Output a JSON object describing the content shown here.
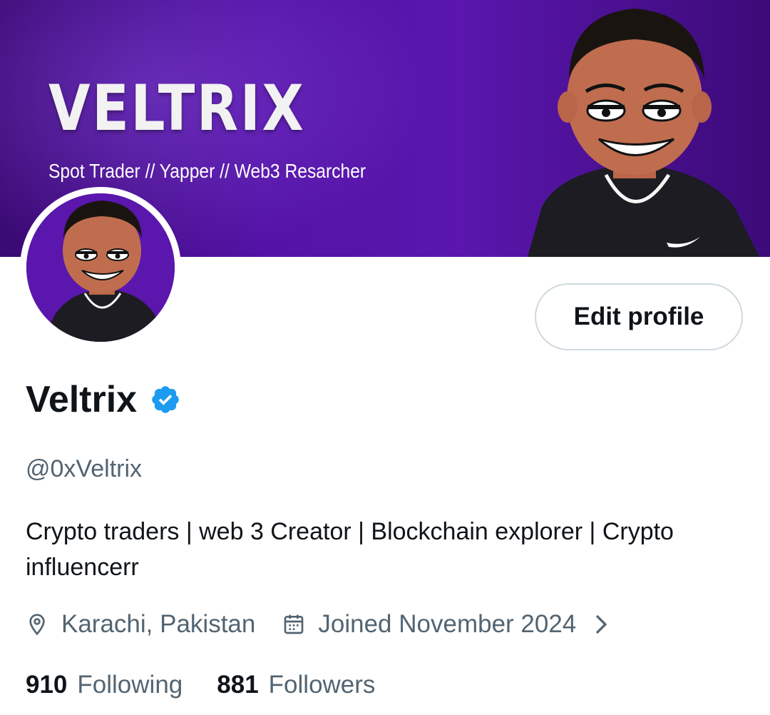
{
  "banner": {
    "title": "VELTRIX",
    "subtitle": "Spot Trader // Yapper // Web3 Resarcher"
  },
  "profile": {
    "display_name": "Veltrix",
    "handle": "@0xVeltrix",
    "bio": "Crypto traders | web 3 Creator | Blockchain explorer | Crypto influencerr",
    "location": "Karachi, Pakistan",
    "joined": "Joined November 2024",
    "verified_icon": "verified-badge-icon",
    "accent_color": "#1d9bf0"
  },
  "actions": {
    "edit_profile": "Edit profile"
  },
  "stats": {
    "following_count": "910",
    "following_label": "Following",
    "followers_count": "881",
    "followers_label": "Followers"
  },
  "icons": {
    "location": "location-pin-icon",
    "calendar": "calendar-icon",
    "chevron": "chevron-right-icon"
  }
}
